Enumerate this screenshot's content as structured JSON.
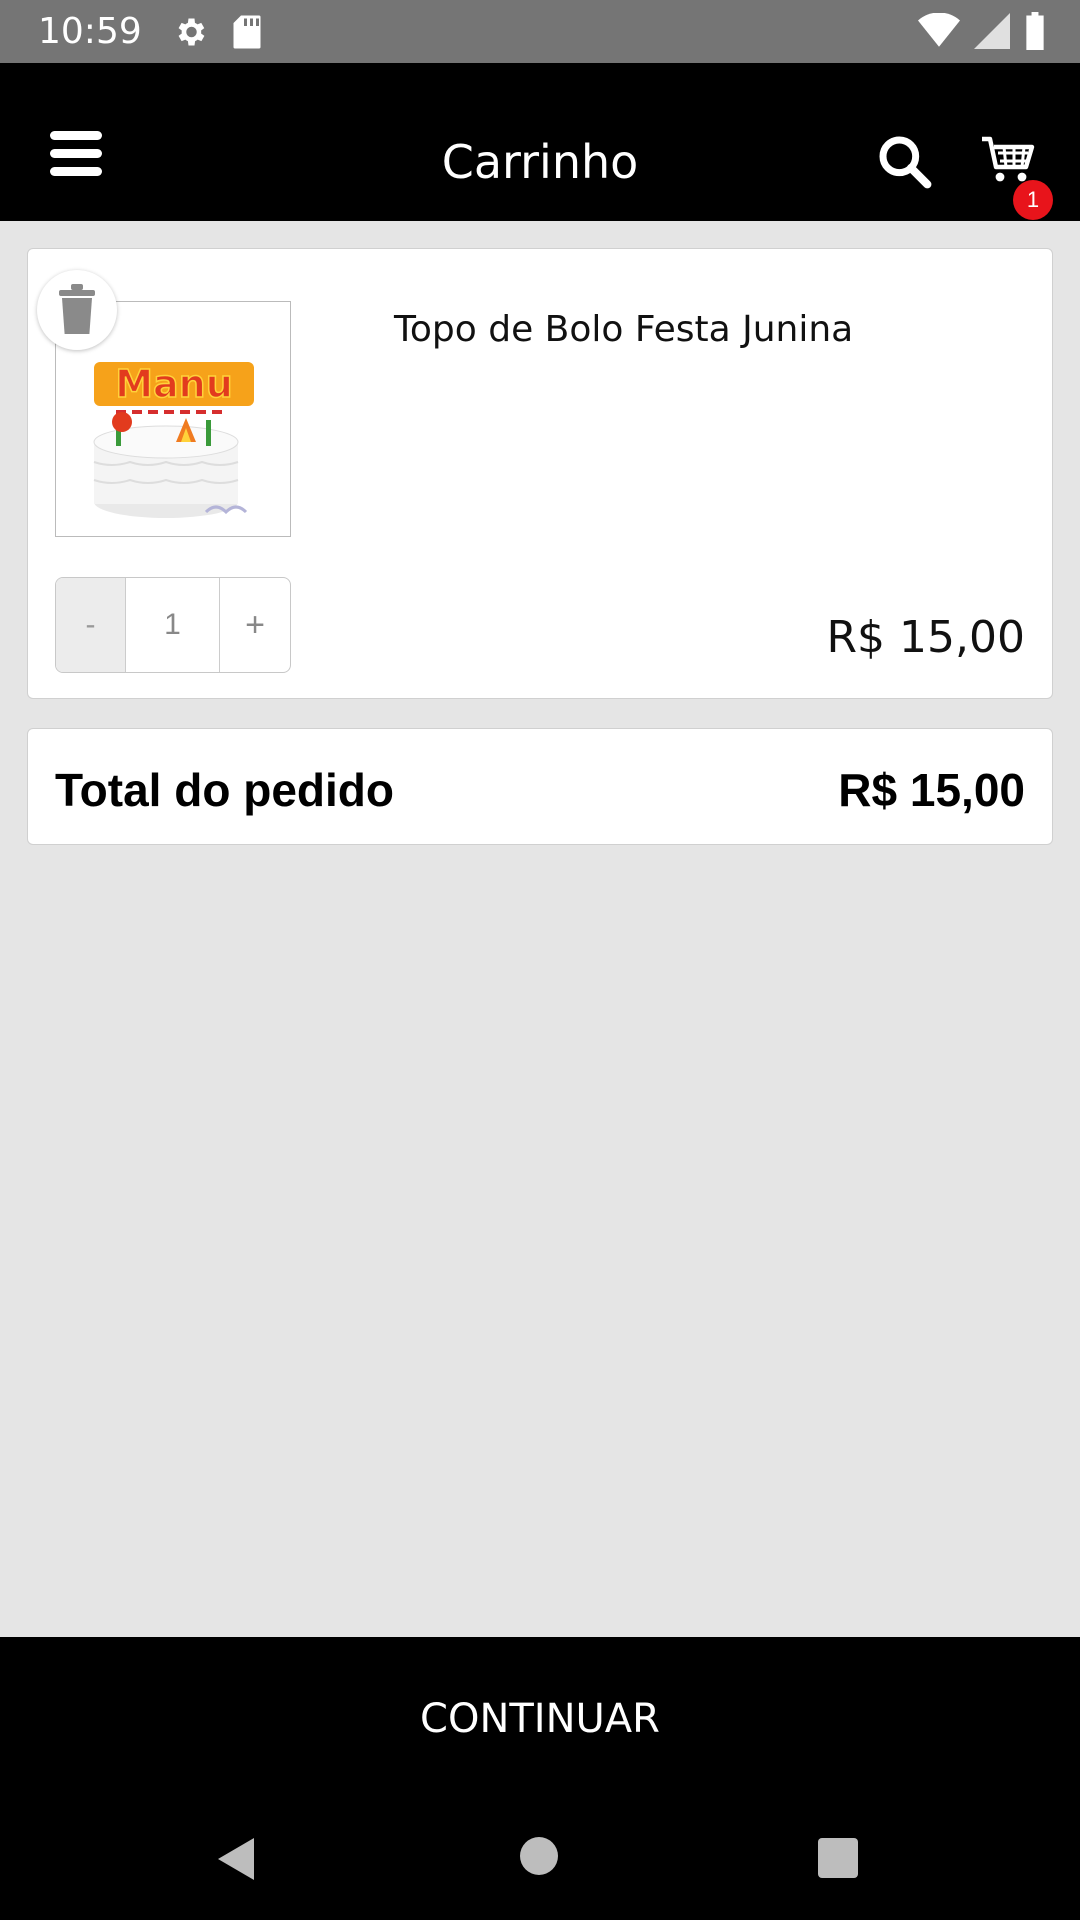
{
  "status_bar": {
    "time": "10:59"
  },
  "header": {
    "title": "Carrinho",
    "icons": [
      "menu-icon",
      "search-icon",
      "cart-icon"
    ],
    "cart_count": "1"
  },
  "cart": {
    "items": [
      {
        "name": "Topo de Bolo Festa Junina",
        "quantity": "1",
        "minus_label": "-",
        "plus_label": "+",
        "price": "R$ 15,00",
        "image_caption": "Manu"
      }
    ],
    "total_label": "Total do pedido",
    "total_value": "R$ 15,00"
  },
  "footer": {
    "continue_label": "CONTINUAR"
  },
  "colors": {
    "badge": "#e8141b",
    "header_bg": "#000000",
    "page_bg": "#e5e5e5"
  }
}
